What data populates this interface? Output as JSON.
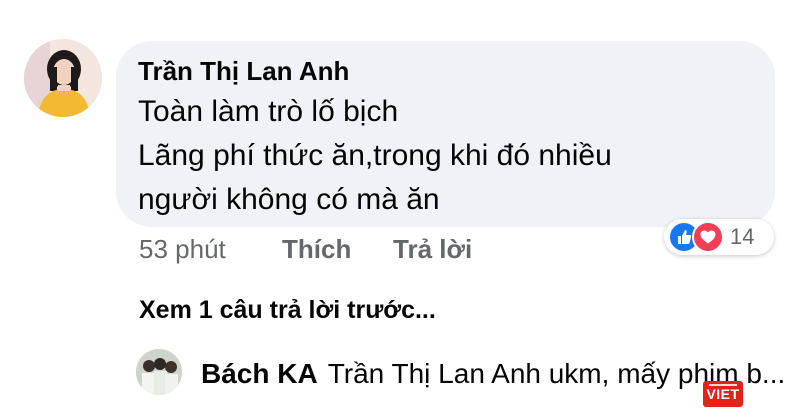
{
  "comment": {
    "author": "Trần Thị Lan Anh",
    "lines": [
      "Toàn làm trò lố bịch",
      "Lãng phí thức ăn,trong khi đó nhiều",
      "người không có mà ăn"
    ],
    "reactions": {
      "icons": [
        "like-icon",
        "love-icon"
      ],
      "count": "14"
    },
    "actions": {
      "time": "53 phút",
      "like_label": "Thích",
      "reply_label": "Trả lời"
    }
  },
  "view_previous_replies": "Xem 1 câu trả lời trước...",
  "reply_preview": {
    "author": "Bách KA",
    "text": "Trần Thị Lan Anh ukm, mấy phim b..."
  },
  "watermark": {
    "text": "VIET"
  },
  "colors": {
    "bubble_bg": "#f0f2f5",
    "secondary_text": "#65676b",
    "like_blue": "#1877f2",
    "love_red": "#f33e58",
    "watermark_red": "#e2231a"
  }
}
